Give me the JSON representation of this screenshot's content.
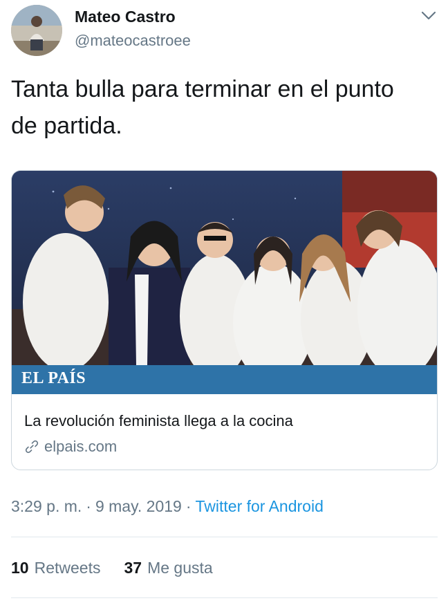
{
  "user": {
    "display_name": "Mateo Castro",
    "handle": "@mateocastroee",
    "avatar_icon": "profile-photo"
  },
  "tweet": {
    "text": "Tanta bulla para terminar en el punto de partida."
  },
  "card": {
    "image": "photo-of-six-chefs-in-white-jackets",
    "brand": "EL PAÍS",
    "brand_color": "#2e73a8",
    "title": "La revolución feminista llega a la cocina",
    "domain": "elpais.com",
    "link_icon": "link-icon"
  },
  "meta": {
    "time": "3:29 p. m.",
    "separator": "·",
    "date": "9 may. 2019",
    "source": "Twitter for Android",
    "source_color": "#1b95e0"
  },
  "stats": {
    "retweets_count": "10",
    "retweets_label": "Retweets",
    "likes_count": "37",
    "likes_label": "Me gusta"
  },
  "icons": {
    "menu": "chevron-down-icon"
  }
}
